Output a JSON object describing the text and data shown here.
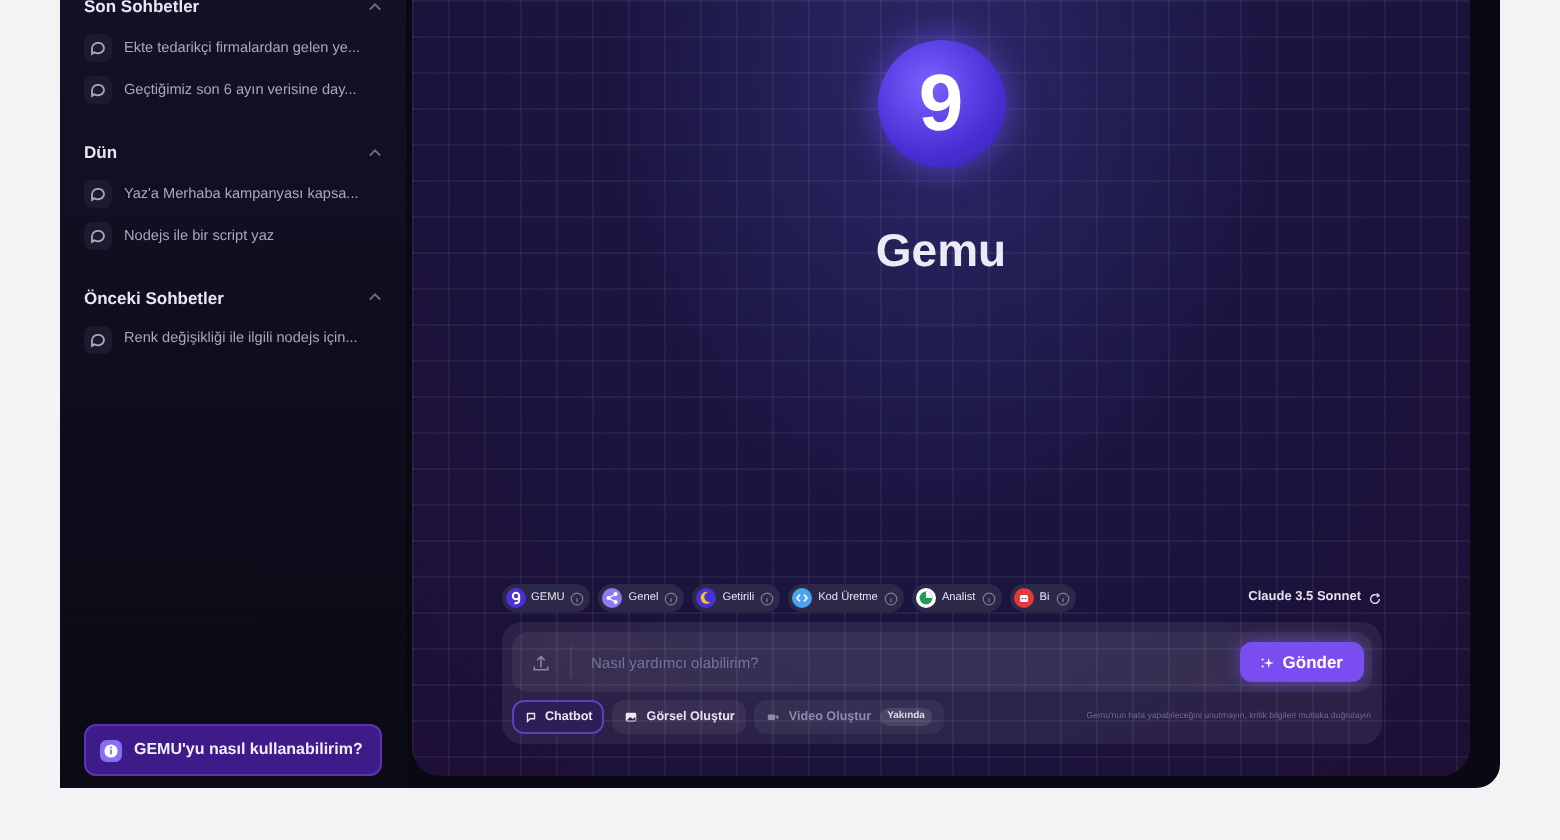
{
  "sidebar": {
    "sections": [
      {
        "title": "Son Sohbetler",
        "expanded": true,
        "items": [
          "Ekte tedarikçi firmalardan gelen ye...",
          "Geçtiğimiz son 6 ayın verisine day..."
        ]
      },
      {
        "title": "Dün",
        "expanded": true,
        "items": [
          "Yaz'a Merhaba kampanyası kapsa...",
          "Nodejs ile bir script yaz"
        ]
      },
      {
        "title": "Önceki Sohbetler",
        "expanded": true,
        "items": [
          "Renk değişikliği ile ilgili nodejs için..."
        ]
      }
    ],
    "help_button": "GEMU'yu nasıl kullanabilirim?"
  },
  "hero": {
    "logo": "9",
    "title": "Gemu"
  },
  "agents": [
    {
      "label": "GEMU",
      "kind": "gemu",
      "selected": false
    },
    {
      "label": "Genel",
      "kind": "share",
      "selected": false
    },
    {
      "label": "Getirili",
      "kind": "moon",
      "selected": false
    },
    {
      "label": "Kod Üretme",
      "kind": "code",
      "selected": false
    },
    {
      "label": "Analist",
      "kind": "pie",
      "selected": false
    },
    {
      "label": "Bi",
      "kind": "bot",
      "selected": false
    }
  ],
  "model": "Claude 3.5 Sonnet",
  "composer": {
    "placeholder": "Nasıl yardımcı olabilirim?",
    "send": "Gönder",
    "modes": [
      {
        "label": "Chatbot",
        "kind": "chat",
        "selected": true,
        "disabled": false
      },
      {
        "label": "Görsel Oluştur",
        "kind": "image",
        "selected": false,
        "disabled": false
      },
      {
        "label": "Video Oluştur",
        "kind": "video",
        "selected": false,
        "disabled": true,
        "badge": "Yakında"
      }
    ],
    "disclaimer": "Gemu'nun hata yapabileceğini unutmayın, kritik bilgileri mutlaka doğrulayın"
  }
}
